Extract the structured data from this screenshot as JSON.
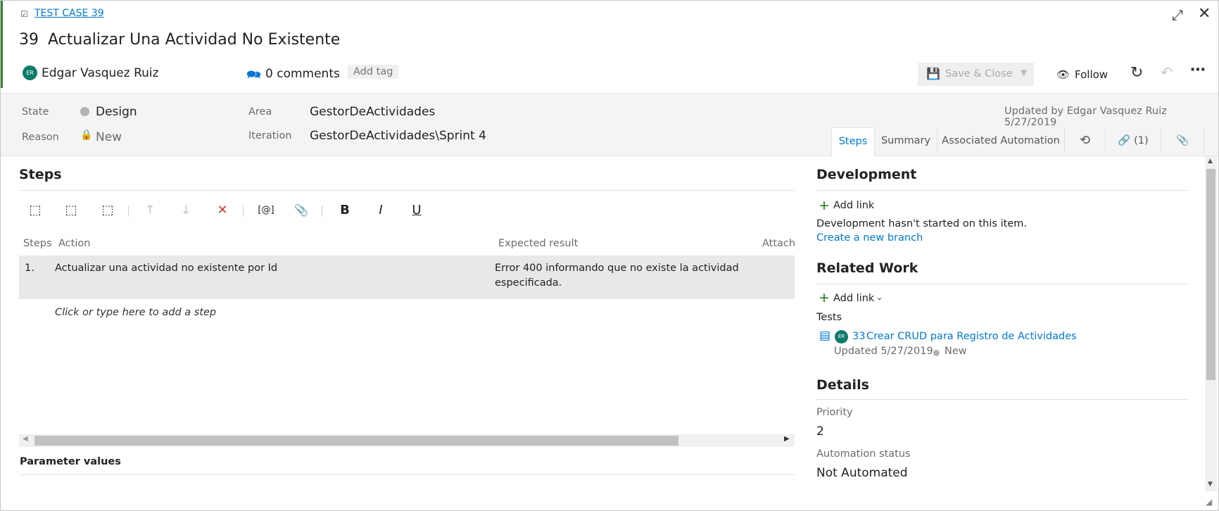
{
  "header": {
    "type_label": "TEST CASE 39",
    "id": "39",
    "title": "Actualizar Una Actividad No Existente",
    "avatar_initials": "ER",
    "assignee": "Edgar Vasquez Ruiz",
    "comments": "0 comments",
    "add_tag": "Add tag",
    "save_close": "Save & Close",
    "follow": "Follow",
    "updated_by": "Updated by Edgar Vasquez Ruiz 5/27/2019"
  },
  "fields": {
    "state_label": "State",
    "state_value": "Design",
    "reason_label": "Reason",
    "reason_value": "New",
    "area_label": "Area",
    "area_value": "GestorDeActividades",
    "iteration_label": "Iteration",
    "iteration_value": "GestorDeActividades\\Sprint 4"
  },
  "tabs": {
    "steps": "Steps",
    "summary": "Summary",
    "automation": "Associated Automation",
    "links_count": "(1)"
  },
  "steps_panel": {
    "title": "Steps",
    "columns": {
      "steps": "Steps",
      "action": "Action",
      "expected": "Expected result",
      "attachments": "Attachı"
    },
    "rows": [
      {
        "num": "1.",
        "action": "Actualizar una actividad no existente por Id",
        "expected_line1": "Error 400 informando que no existe la actividad",
        "expected_line2": "especificada."
      }
    ],
    "add_step_hint": "Click or type here to add a step",
    "parameter_values": "Parameter values",
    "toolbar": {
      "insert_param": "[@]",
      "bold": "B",
      "italic": "I",
      "underline": "U"
    }
  },
  "development": {
    "title": "Development",
    "add_link": "Add link",
    "message": "Development hasn't started on this item.",
    "create_branch": "Create a new branch"
  },
  "related_work": {
    "title": "Related Work",
    "add_link": "Add link",
    "group": "Tests",
    "item_avatar": "ER",
    "item_id": "33",
    "item_title": "Crear CRUD para Registro de Actividades",
    "item_updated": "Updated 5/27/2019,",
    "item_state": "New"
  },
  "details": {
    "title": "Details",
    "priority_label": "Priority",
    "priority_value": "2",
    "automation_label": "Automation status",
    "automation_value": "Not Automated"
  },
  "colors": {
    "accent": "#3a7d3a",
    "link": "#0078d4",
    "avatar": "#0f7b6c",
    "delete": "#d13438",
    "add": "#107c10"
  }
}
